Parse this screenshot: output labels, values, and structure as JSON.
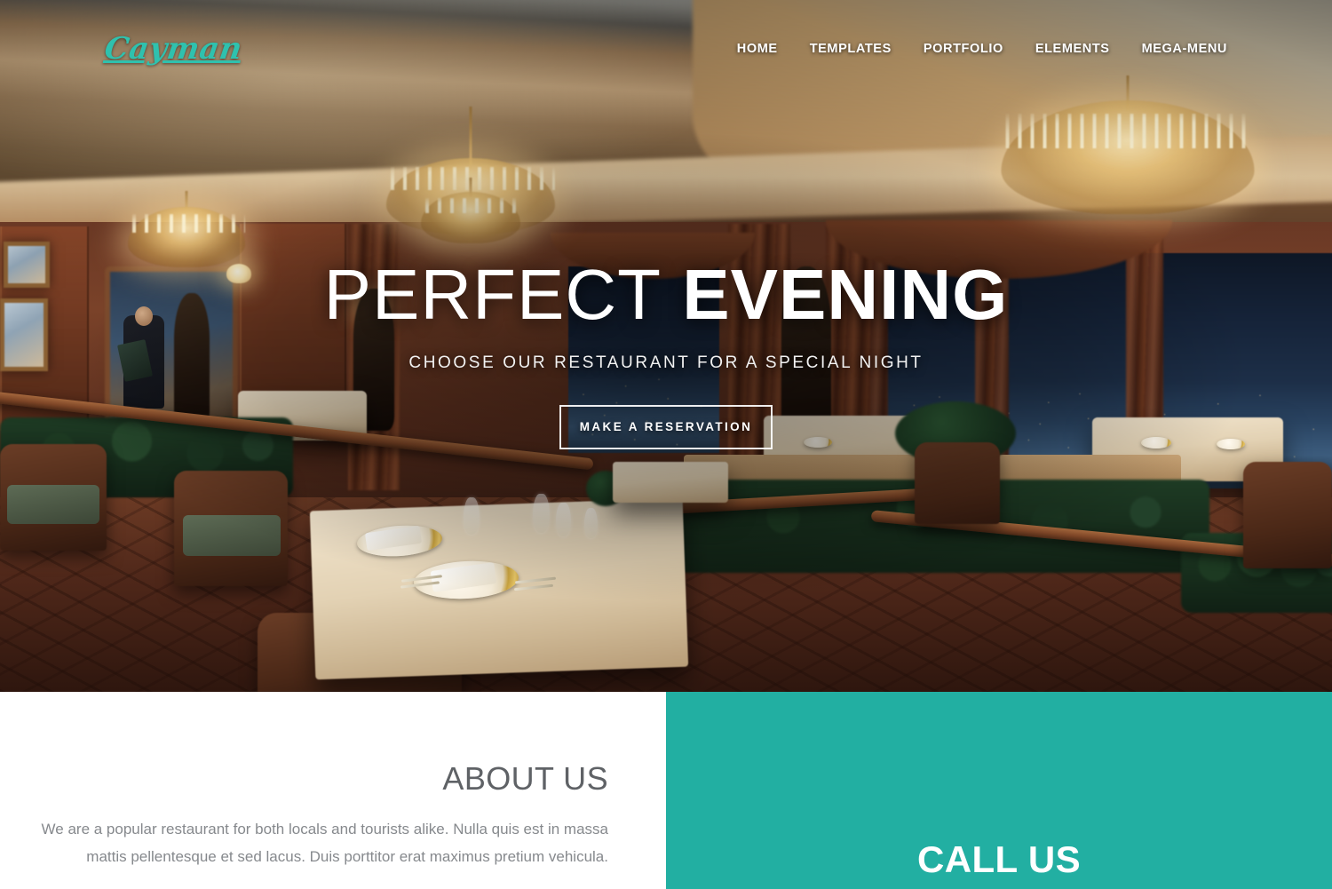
{
  "brand": {
    "logo_text": "Cayman",
    "accent_color": "#2fc1ae",
    "teal_color": "#22afa2"
  },
  "nav": {
    "items": [
      {
        "label": "HOME"
      },
      {
        "label": "TEMPLATES"
      },
      {
        "label": "PORTFOLIO"
      },
      {
        "label": "ELEMENTS"
      },
      {
        "label": "MEGA-MENU"
      }
    ]
  },
  "hero": {
    "title_light": "PERFECT",
    "title_bold": "EVENING",
    "subtitle": "CHOOSE OUR RESTAURANT FOR A SPECIAL NIGHT",
    "button_label": "MAKE A RESERVATION",
    "image_description": "Elegant fine-dining restaurant interior at night with crystal chandeliers, set tables and a city skyline view"
  },
  "about": {
    "heading": "ABOUT US",
    "body": "We are a popular restaurant for both locals and tourists alike. Nulla quis est in massa mattis pellentesque et sed lacus. Duis porttitor erat maximus pretium vehicula."
  },
  "call_us": {
    "heading": "CALL US"
  }
}
